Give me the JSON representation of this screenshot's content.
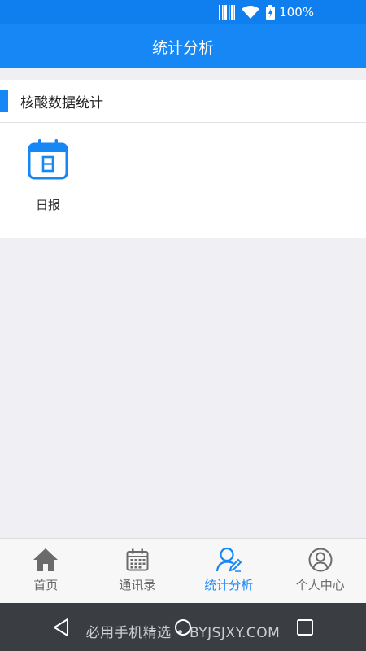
{
  "status_bar": {
    "battery_text": "100%"
  },
  "title_bar": {
    "title": "统计分析"
  },
  "section": {
    "title": "核酸数据统计",
    "items": [
      {
        "label": "日报",
        "icon": "calendar-icon",
        "icon_glyph": "日"
      }
    ]
  },
  "tab_bar": {
    "tabs": [
      {
        "label": "首页",
        "icon": "home-icon",
        "active": false
      },
      {
        "label": "通讯录",
        "icon": "calendar-grid-icon",
        "active": false
      },
      {
        "label": "统计分析",
        "icon": "user-edit-icon",
        "active": true
      },
      {
        "label": "个人中心",
        "icon": "user-circle-icon",
        "active": false
      }
    ]
  },
  "watermark": "必用手机精选 • BYJSJXY.COM",
  "colors": {
    "primary": "#1687f5",
    "status_bar": "#0f7ff0",
    "background": "#efeff4",
    "inactive_tab": "#6b6b6b",
    "nav_bar": "#3a3d42"
  }
}
